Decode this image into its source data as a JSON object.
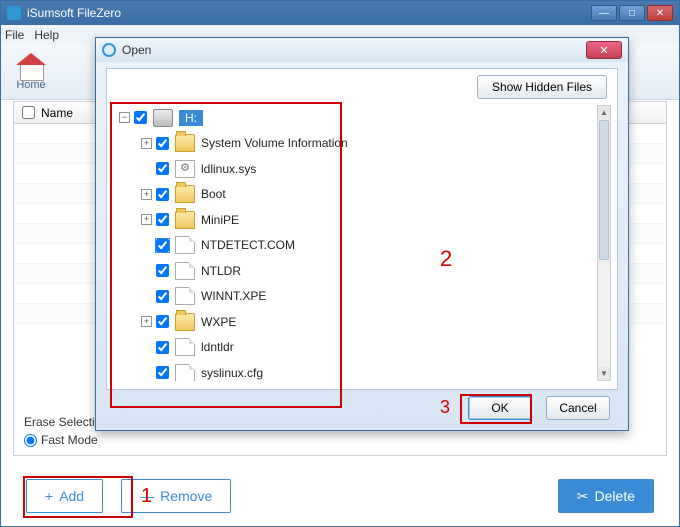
{
  "app": {
    "title": "iSumsoft FileZero",
    "menu": {
      "file": "File",
      "help": "Help"
    },
    "home": "Home"
  },
  "list": {
    "header": "Name",
    "eraseLabel": "Erase Selection",
    "fastLabel": "Fast Mode"
  },
  "footer": {
    "add": "Add",
    "remove": "Remove",
    "delete": "Delete"
  },
  "dialog": {
    "title": "Open",
    "showHidden": "Show Hidden Files",
    "ok": "OK",
    "cancel": "Cancel",
    "tree": {
      "root": {
        "label": "H:",
        "selected": true,
        "checked": true,
        "expandable": true,
        "icon": "drive"
      },
      "children": [
        {
          "label": "System Volume Information",
          "checked": true,
          "expandable": true,
          "icon": "folder"
        },
        {
          "label": "ldlinux.sys",
          "checked": true,
          "expandable": false,
          "icon": "sys"
        },
        {
          "label": "Boot",
          "checked": true,
          "expandable": true,
          "icon": "folder"
        },
        {
          "label": "MiniPE",
          "checked": true,
          "expandable": true,
          "icon": "folder"
        },
        {
          "label": "NTDETECT.COM",
          "checked": true,
          "expandable": false,
          "icon": "file",
          "marked": true
        },
        {
          "label": "NTLDR",
          "checked": true,
          "expandable": false,
          "icon": "file"
        },
        {
          "label": "WINNT.XPE",
          "checked": true,
          "expandable": false,
          "icon": "file"
        },
        {
          "label": "WXPE",
          "checked": true,
          "expandable": true,
          "icon": "folder"
        },
        {
          "label": "ldntldr",
          "checked": true,
          "expandable": false,
          "icon": "file"
        },
        {
          "label": "syslinux.cfg",
          "checked": true,
          "expandable": false,
          "icon": "file"
        }
      ]
    }
  },
  "annotations": {
    "one": "1",
    "two": "2",
    "three": "3"
  }
}
